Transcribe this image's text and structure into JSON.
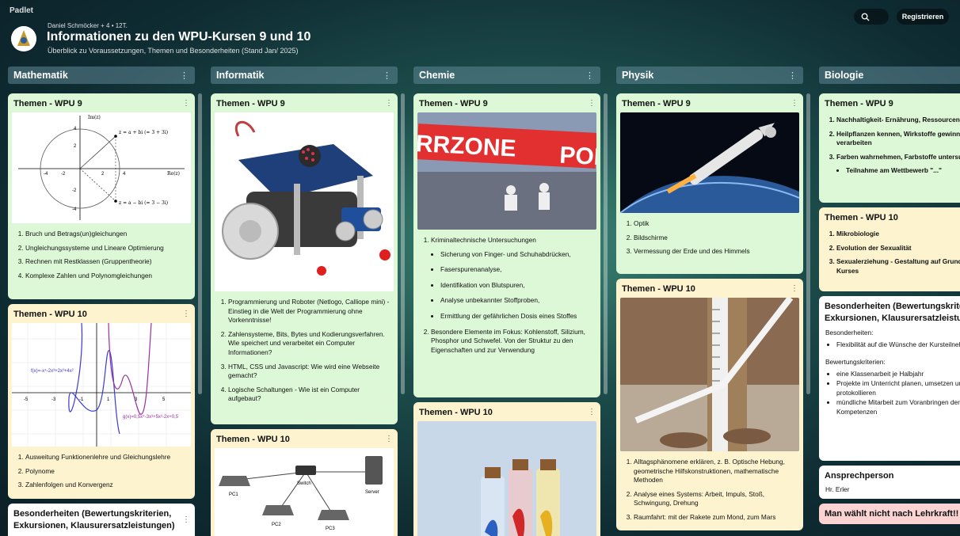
{
  "brand": "Padlet",
  "header": {
    "author": "Daniel Schmöcker + 4 • 12T.",
    "title": "Informationen zu den WPU-Kursen 9 und 10",
    "subtitle": "Überblick zu Voraussetzungen, Themen und Besonderheiten (Stand Jan/ 2025)",
    "register": "Registrieren"
  },
  "columns": {
    "math": {
      "title": "Mathematik",
      "c1": {
        "title": "Themen - WPU 9",
        "items": [
          "Bruch und Betrags(un)gleichungen",
          "Ungleichungssysteme und Lineare Optimierung",
          "Rechnen mit Restklassen (Gruppentheorie)",
          "Komplexe Zahlen und Polynomgleichungen"
        ]
      },
      "c2": {
        "title": "Themen - WPU 10",
        "items": [
          "Ausweitung Funktionenlehre und Gleichungslehre",
          "Polynome",
          "Zahlenfolgen und Konvergenz"
        ],
        "f1": "f(x)=-x⁴-2x³+2x²+4x²",
        "f2": "g(x)=0,5x⁴-3x³+5x²-2x+0,5"
      },
      "c3": {
        "title": "Besonderheiten (Bewertungskriterien, Exkursionen, Klausurersatzleistungen)"
      }
    },
    "info": {
      "title": "Informatik",
      "c1": {
        "title": "Themen - WPU 9",
        "items": [
          "Programmierung und Roboter (Netlogo, Calliope mini) - Einstieg in die Welt der Programmierung ohne Vorkenntnisse!",
          "Zahlensysteme, Bits, Bytes und Kodierungsverfahren. Wie speichert und verarbeitet ein Computer Informationen?",
          "HTML, CSS und Javascript: Wie wird eine Webseite gemacht?",
          "Logische Schaltungen - Wie ist ein Computer aufgebaut?"
        ]
      },
      "c2": {
        "title": "Themen - WPU 10",
        "net": [
          "PC1",
          "Switch",
          "Server",
          "PC2",
          "PC3"
        ]
      }
    },
    "chem": {
      "title": "Chemie",
      "c1": {
        "title": "Themen - WPU 9",
        "tape": "RRZONE",
        "tape2": "POL",
        "i1": "Kriminaltechnische Untersuchungen",
        "sub": [
          "Sicherung von Finger- und Schuhabdrücken,",
          "Faserspurenanalyse,",
          "Identifikation von Blutspuren,",
          "Analyse unbekannter Stoffproben,",
          "Ermittlung der gefährlichen Dosis eines Stoffes"
        ],
        "i2": "Besondere Elemente im Fokus: Kohlenstoff, Silizium, Phosphor und Schwefel. Von der Struktur zu den Eigenschaften und zur Verwendung"
      },
      "c2": {
        "title": "Themen - WPU 10"
      }
    },
    "phys": {
      "title": "Physik",
      "c1": {
        "title": "Themen - WPU 9",
        "items": [
          "Optik",
          "Bildschirme",
          "Vermessung der Erde und des Himmels"
        ]
      },
      "c2": {
        "title": "Themen - WPU 10",
        "items": [
          "Alltagsphänomene erklären, z. B. Optische Hebung, geometrische Hilfskonstruktionen, mathematische Methoden",
          "Analyse eines Systems: Arbeit, Impuls, Stoß, Schwingung, Drehung",
          "Raumfahrt: mit der Rakete zum Mond, zum Mars"
        ]
      }
    },
    "bio": {
      "title": "Biologie",
      "c1": {
        "title": "Themen - WPU 9",
        "items": [
          "Nachhaltigkeit- Ernährung, Ressourcen, Recycling",
          "Heilpflanzen kennen, Wirkstoffe gewinnen, verarbeiten",
          "Farben wahrnehmen, Farbstoffe untersuchen"
        ],
        "sub": "Teilnahme am Wettbewerb \"...\""
      },
      "c2": {
        "title": "Themen - WPU 10",
        "items": [
          "Mikrobiologie",
          "Evolution der Sexualität",
          "Sexualerziehung - Gestaltung auf Grundlage des Kurses"
        ]
      },
      "c3": {
        "title": "Besonderheiten (Bewertungskriterien, Exkursionen, Klausurersatzleistungen)",
        "l1": "Besonderheiten:",
        "b1": [
          "Flexibilität auf die Wünsche der Kursteilnehmer"
        ],
        "l2": "Bewertungskriterien:",
        "b2": [
          "eine Klassenarbeit je Halbjahr",
          "Projekte im Unterricht planen, umsetzen und protokollieren",
          "mündliche Mitarbeit zum Voranbringen der individuellen Kompetenzen"
        ]
      },
      "c4": {
        "title": "Ansprechperson",
        "text": "Hr. Erler"
      },
      "c5": {
        "title": "Man wählt nicht nach Lehrkraft!!"
      }
    }
  },
  "colors": {
    "green": "#dcf8d6",
    "yellow": "#fdf3cf",
    "pink": "#fbd3d3"
  }
}
